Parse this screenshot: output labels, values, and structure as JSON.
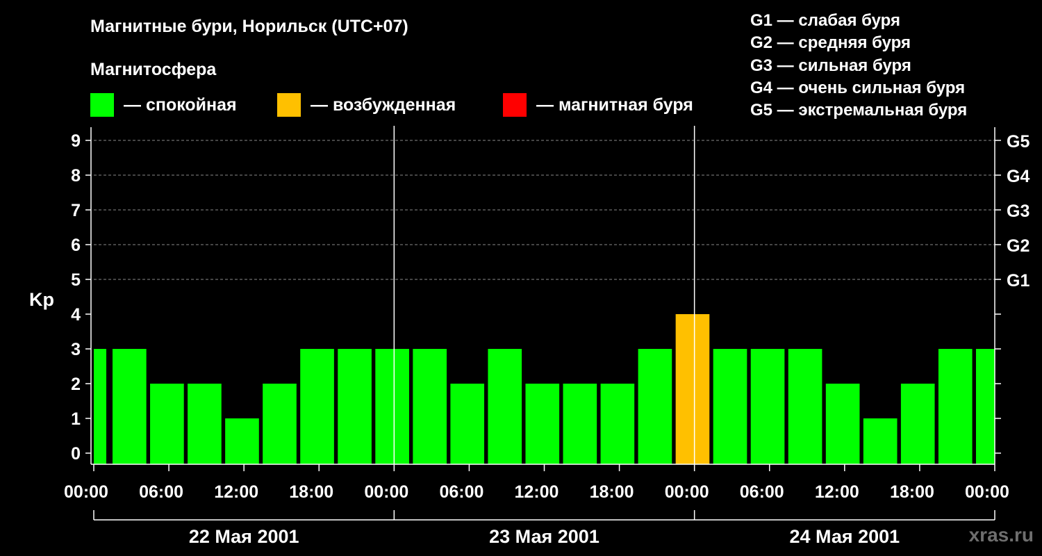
{
  "title": "Магнитные бури, Норильск (UTC+07)",
  "subtitle": "Магнитосфера",
  "legend": [
    {
      "label": "— спокойная",
      "color": "#00ff00"
    },
    {
      "label": "— возбужденная",
      "color": "#ffc000"
    },
    {
      "label": "— магнитная буря",
      "color": "#ff0000"
    }
  ],
  "g_legend": [
    "G1 — слабая буря",
    "G2 — средняя буря",
    "G3 — сильная буря",
    "G4 — очень сильная буря",
    "G5 — экстремальная буря"
  ],
  "watermark": "xras.ru",
  "chart_data": {
    "type": "bar",
    "ylabel": "Kp",
    "ylim": [
      0,
      9
    ],
    "yticks": [
      "0",
      "1",
      "2",
      "3",
      "4",
      "5",
      "6",
      "7",
      "8",
      "9"
    ],
    "right_ticks": [
      {
        "value": 5,
        "label": "G1"
      },
      {
        "value": 6,
        "label": "G2"
      },
      {
        "value": 7,
        "label": "G3"
      },
      {
        "value": 8,
        "label": "G4"
      },
      {
        "value": 9,
        "label": "G5"
      }
    ],
    "grid": "dashed horizontal at integer Kp from 5 to 9",
    "xticks": [
      "00:00",
      "06:00",
      "12:00",
      "18:00",
      "00:00",
      "06:00",
      "12:00",
      "18:00",
      "00:00",
      "06:00",
      "12:00",
      "18:00",
      "00:00"
    ],
    "days": [
      "22 Мая 2001",
      "23 Мая 2001",
      "24 Мая 2001"
    ],
    "x_range_hours": [
      0,
      72
    ],
    "bar_start_hours": [
      0,
      1.5,
      4.5,
      7.5,
      10.5,
      13.5,
      16.5,
      19.5,
      22.5,
      25.5,
      28.5,
      31.5,
      34.5,
      37.5,
      40.5,
      43.5,
      46.5,
      49.5,
      52.5,
      55.5,
      58.5,
      61.5,
      64.5,
      67.5,
      70.5
    ],
    "bar_end_hours": [
      1,
      4.2,
      7.2,
      10.2,
      13.2,
      16.2,
      19.2,
      22.2,
      25.2,
      28.2,
      31.2,
      34.2,
      37.2,
      40.2,
      43.2,
      46.2,
      49.2,
      52.2,
      55.2,
      58.2,
      61.2,
      64.2,
      67.2,
      70.2,
      72
    ],
    "values": [
      3,
      3,
      2,
      2,
      1,
      2,
      3,
      3,
      3,
      3,
      2,
      3,
      2,
      2,
      2,
      3,
      4,
      3,
      3,
      3,
      2,
      1,
      2,
      3,
      3
    ],
    "colors": [
      "#00ff00",
      "#00ff00",
      "#00ff00",
      "#00ff00",
      "#00ff00",
      "#00ff00",
      "#00ff00",
      "#00ff00",
      "#00ff00",
      "#00ff00",
      "#00ff00",
      "#00ff00",
      "#00ff00",
      "#00ff00",
      "#00ff00",
      "#00ff00",
      "#ffc000",
      "#00ff00",
      "#00ff00",
      "#00ff00",
      "#00ff00",
      "#00ff00",
      "#00ff00",
      "#00ff00",
      "#00ff00"
    ]
  }
}
